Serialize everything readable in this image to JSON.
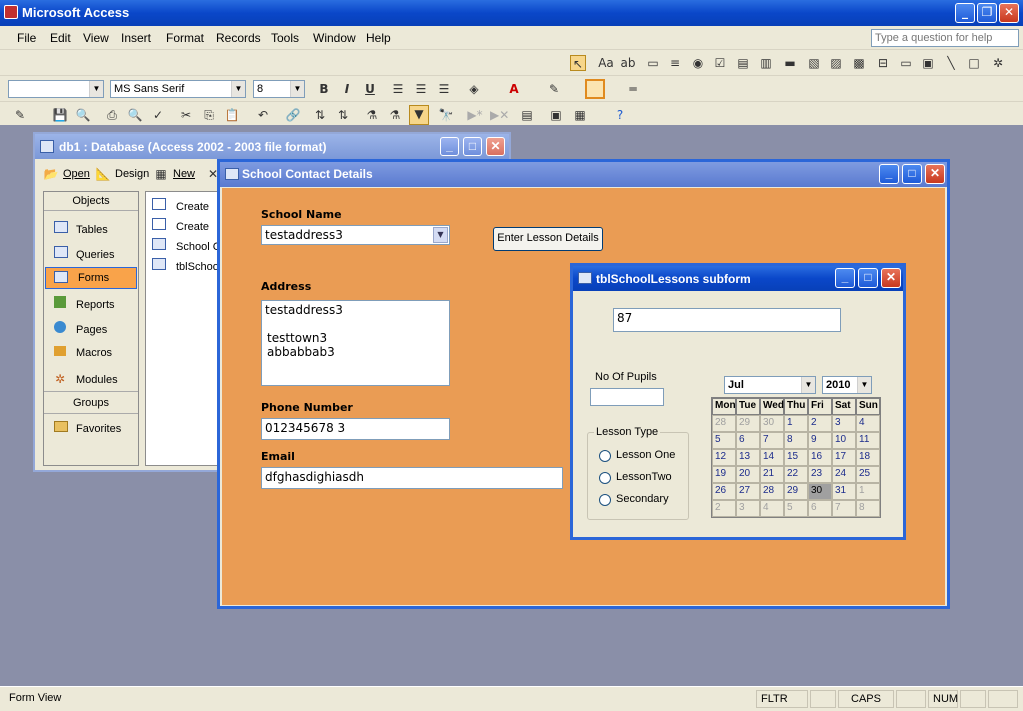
{
  "app": {
    "title": "Microsoft Access"
  },
  "menu": {
    "items": [
      "File",
      "Edit",
      "View",
      "Insert",
      "Format",
      "Records",
      "Tools",
      "Window",
      "Help"
    ],
    "help_placeholder": "Type a question for help"
  },
  "format_toolbar": {
    "font": "MS Sans Serif",
    "size": "8",
    "bold": "B",
    "italic": "I",
    "underline": "U"
  },
  "db_window": {
    "title": "db1 : Database (Access 2002 - 2003 file format)",
    "toolbar": {
      "open": "Open",
      "design": "Design",
      "new": "New"
    },
    "objects_header": "Objects",
    "objects": [
      "Tables",
      "Queries",
      "Forms",
      "Reports",
      "Pages",
      "Macros",
      "Modules"
    ],
    "groups_header": "Groups",
    "favorites": "Favorites",
    "list": [
      "Create",
      "Create",
      "School C",
      "tblSchoo"
    ]
  },
  "form": {
    "title": "School Contact Details",
    "school_name_label": "School Name",
    "school_name_value": "testaddress3",
    "button": "Enter Lesson Details",
    "address_label": "Address",
    "address_line1": "testaddress3",
    "address_line2": "testtown3",
    "address_line3": "abbabbab3",
    "phone_label": "Phone Number",
    "phone_value": "012345678 3",
    "email_label": "Email",
    "email_value": "dfghasdighiasdh"
  },
  "subform": {
    "title": "tblSchoolLessons subform",
    "id_value": "87",
    "pupils_label": "No Of Pupils",
    "pupils_value": "",
    "lesson_type_label": "Lesson Type",
    "options": [
      "Lesson One",
      "LessonTwo",
      "Secondary"
    ],
    "month": "Jul",
    "year": "2010",
    "weekdays": [
      "Mon",
      "Tue",
      "Wed",
      "Thu",
      "Fri",
      "Sat",
      "Sun"
    ],
    "weeks": [
      [
        "28",
        "29",
        "30",
        "1",
        "2",
        "3",
        "4"
      ],
      [
        "5",
        "6",
        "7",
        "8",
        "9",
        "10",
        "11"
      ],
      [
        "12",
        "13",
        "14",
        "15",
        "16",
        "17",
        "18"
      ],
      [
        "19",
        "20",
        "21",
        "22",
        "23",
        "24",
        "25"
      ],
      [
        "26",
        "27",
        "28",
        "29",
        "30",
        "31",
        "1"
      ],
      [
        "2",
        "3",
        "4",
        "5",
        "6",
        "7",
        "8"
      ]
    ],
    "selected_day": "30"
  },
  "status": {
    "mode": "Form View",
    "fltr": "FLTR",
    "caps": "CAPS",
    "num": "NUM"
  }
}
